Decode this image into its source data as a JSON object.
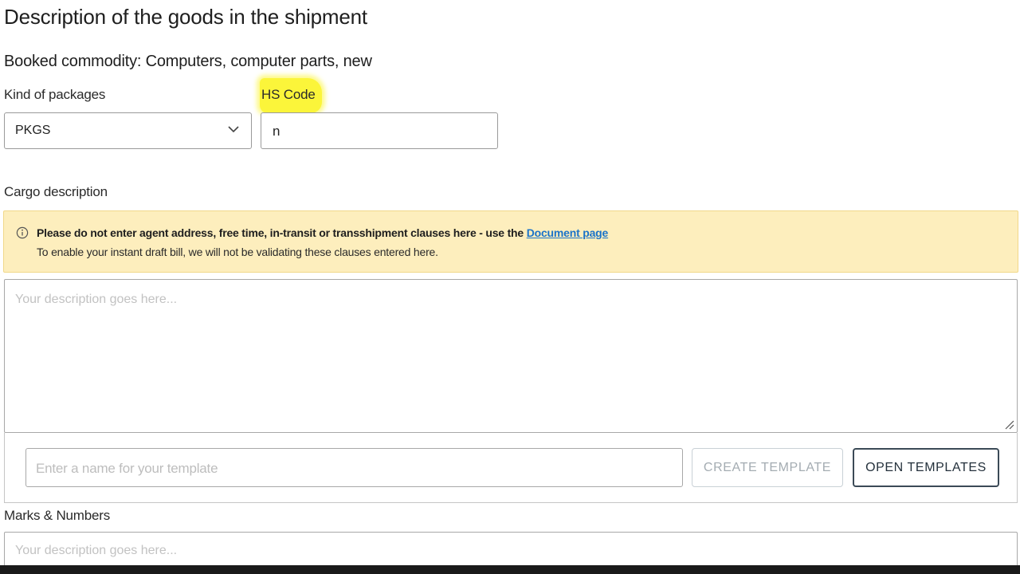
{
  "page": {
    "title": "Description of the goods in the shipment",
    "booked_commodity": "Booked commodity: Computers, computer parts, new"
  },
  "kind_of_packages": {
    "label": "Kind of packages",
    "selected": "PKGS"
  },
  "hs_code": {
    "label": "HS Code",
    "value": "n",
    "highlight_color": "#fbf53a"
  },
  "cargo_description": {
    "label": "Cargo description",
    "warning": {
      "bold_text": "Please do not enter agent address, free time, in-transit or transshipment clauses here - use the ",
      "link_text": "Document page",
      "sub_text": "To enable your instant draft bill, we will not be validating these clauses entered here.",
      "icon": "info-icon",
      "background": "#fdeebd"
    },
    "placeholder": "Your description goes here..."
  },
  "template": {
    "name_placeholder": "Enter a name for your template",
    "create_label": "CREATE TEMPLATE",
    "open_label": "OPEN TEMPLATES"
  },
  "marks_numbers": {
    "label": "Marks & Numbers",
    "placeholder": "Your description goes here..."
  }
}
